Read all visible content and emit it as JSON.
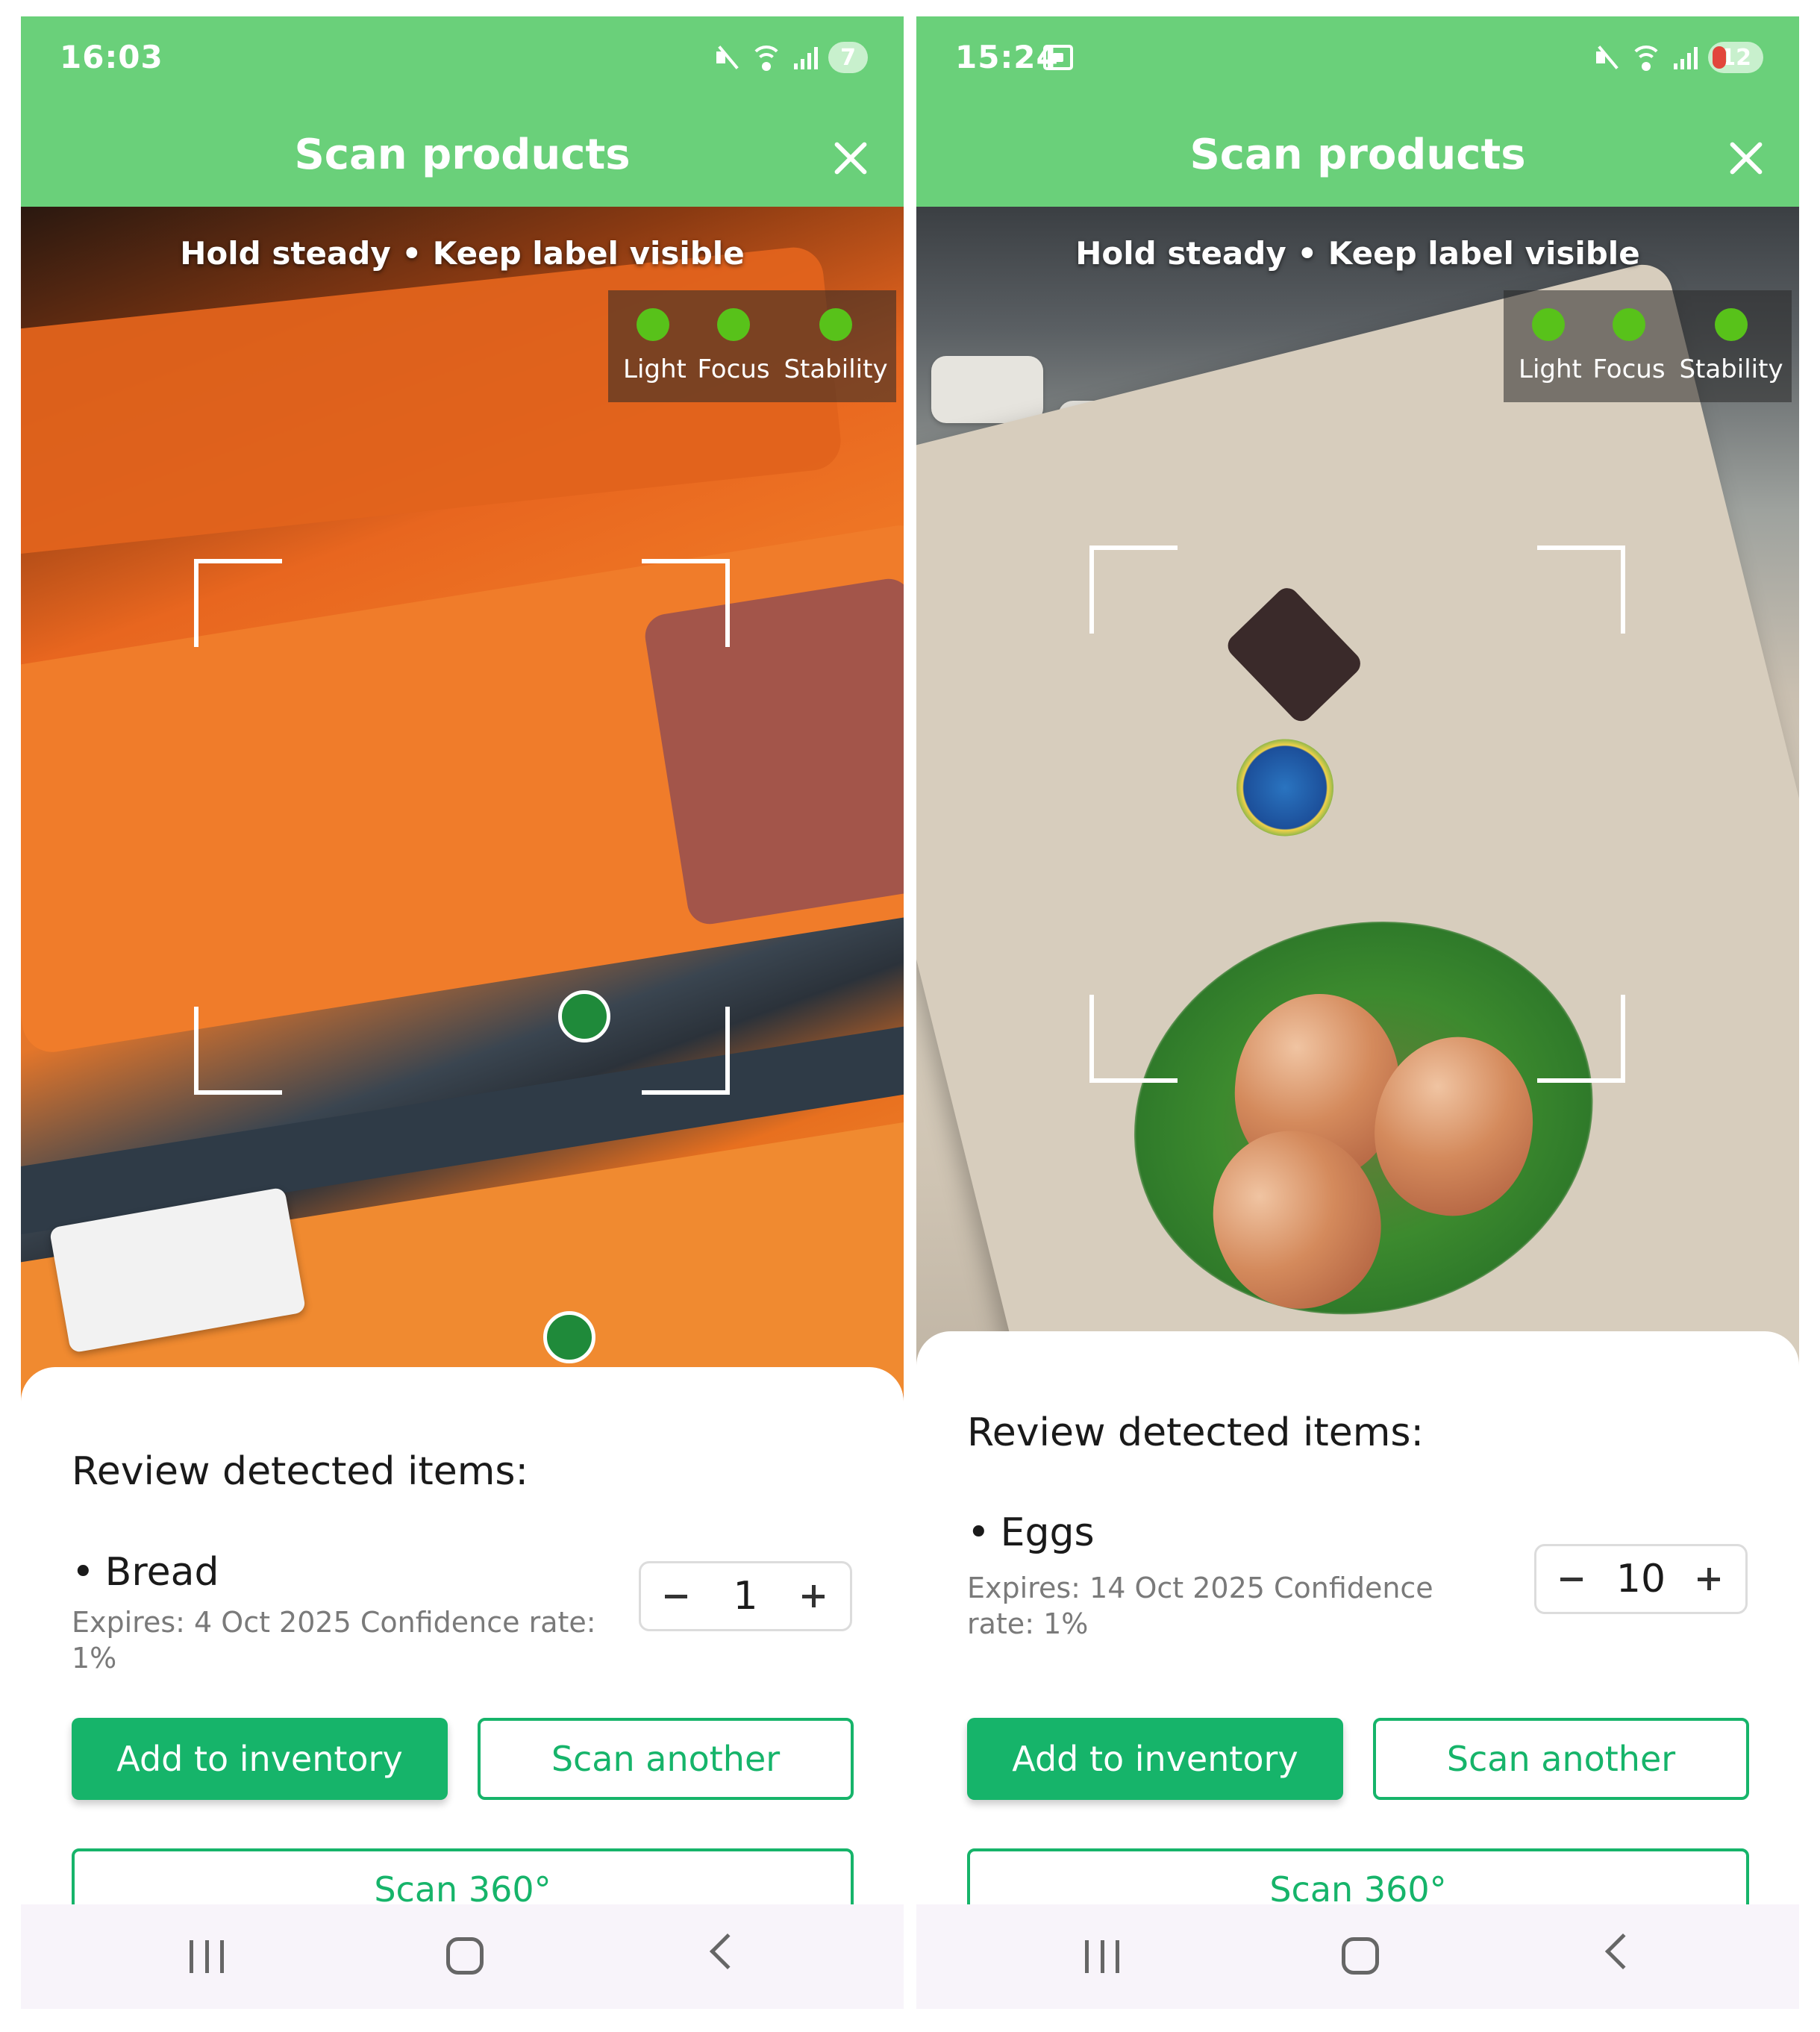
{
  "screens": [
    {
      "status": {
        "time": "16:03",
        "battery": "7"
      },
      "header": {
        "title": "Scan products",
        "close_icon": "close-icon"
      },
      "camera": {
        "hint": "Hold steady • Keep label visible",
        "indicators": [
          {
            "label": "Light",
            "status_color": "#58c21a"
          },
          {
            "label": "Focus",
            "status_color": "#58c21a"
          },
          {
            "label": "Stability",
            "status_color": "#58c21a"
          }
        ]
      },
      "review": {
        "title": "Review detected items:",
        "item": {
          "name": "Bread",
          "details": "Expires: 4 Oct 2025 Confidence rate: 1%",
          "quantity": "1"
        },
        "buttons": {
          "add": "Add to inventory",
          "another": "Scan another",
          "scan360": "Scan 360°"
        }
      }
    },
    {
      "status": {
        "time": "15:24",
        "battery": "12"
      },
      "header": {
        "title": "Scan products",
        "close_icon": "close-icon"
      },
      "camera": {
        "hint": "Hold steady • Keep label visible",
        "indicators": [
          {
            "label": "Light",
            "status_color": "#58c21a"
          },
          {
            "label": "Focus",
            "status_color": "#58c21a"
          },
          {
            "label": "Stability",
            "status_color": "#58c21a"
          }
        ]
      },
      "review": {
        "title": "Review detected items:",
        "item": {
          "name": "Eggs",
          "details": "Expires: 14 Oct 2025 Confidence rate: 1%",
          "quantity": "10"
        },
        "buttons": {
          "add": "Add to inventory",
          "another": "Scan another",
          "scan360": "Scan 360°"
        }
      }
    }
  ],
  "theme": {
    "header_green": "#6ad07a",
    "accent_green": "#16b46a",
    "indicator_ok": "#58c21a"
  }
}
